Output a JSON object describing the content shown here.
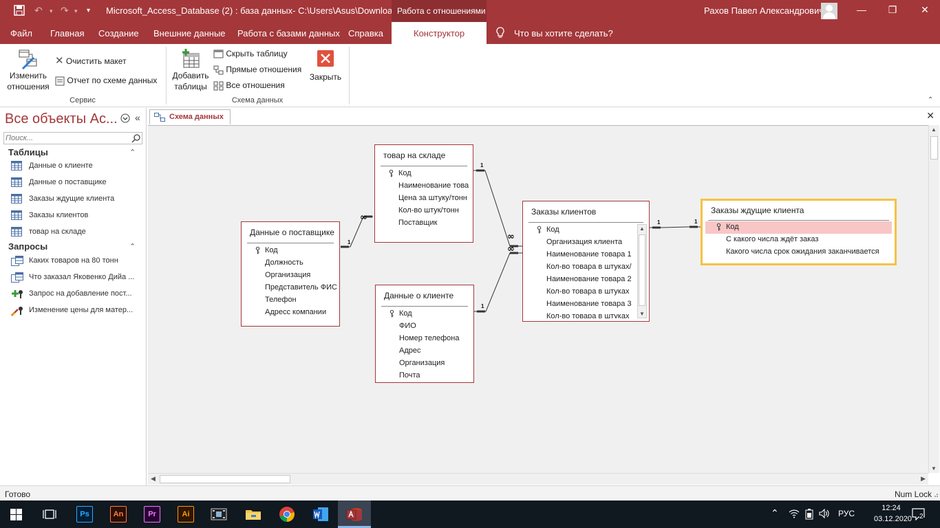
{
  "titlebar": {
    "title": "Microsoft_Access_Database (2) : база данных- C:\\Users\\Asus\\Downloads\\...",
    "context_tab": "Работа с отношениями",
    "user": "Рахов Павел Александрович"
  },
  "tabs": {
    "file": "Файл",
    "home": "Главная",
    "create": "Создание",
    "external": "Внешние данные",
    "database_tools": "Работа с базами данных",
    "help": "Справка",
    "designer": "Конструктор",
    "tell_me": "Что вы хотите сделать?"
  },
  "ribbon": {
    "edit_relationships": [
      "Изменить",
      "отношения"
    ],
    "clear_layout": "Очистить макет",
    "relationship_report": "Отчет по схеме данных",
    "group_tools": "Сервис",
    "add_tables": [
      "Добавить",
      "таблицы"
    ],
    "hide_table": "Скрыть таблицу",
    "direct_relationships": "Прямые отношения",
    "all_relationships": "Все отношения",
    "close": "Закрыть",
    "group_relationships": "Схема данных"
  },
  "nav": {
    "title": "Все объекты Ac...",
    "search_placeholder": "Поиск...",
    "tables_header": "Таблицы",
    "tables": [
      "Данные о клиенте",
      "Данные о поставщике",
      "Заказы ждущие клиента",
      "Заказы клиентов",
      "товар на складе"
    ],
    "queries_header": "Запросы",
    "queries": [
      "Каких товаров на 80 тонн",
      "Что заказал Яковенко Дийа ...",
      "Запрос на добавление пост...",
      "Изменение цены для матер..."
    ]
  },
  "document": {
    "tab_label": "Схема данных"
  },
  "diagram": {
    "tables": [
      {
        "name": "товар на складе",
        "fields": [
          "Код",
          "Наименование това",
          "Цена за штуку/тонн",
          "Кол-во штук/тонн",
          "Поставщик"
        ]
      },
      {
        "name": "Данные о поставщике",
        "fields": [
          "Код",
          "Должность",
          "Организация",
          "Представитель ФИС",
          "Телефон",
          "Адресс компании"
        ]
      },
      {
        "name": "Данные о клиенте",
        "fields": [
          "Код",
          "ФИО",
          "Номер телефона",
          "Адрес",
          "Организация",
          "Почта"
        ]
      },
      {
        "name": "Заказы клиентов",
        "fields": [
          "Код",
          "Организация клиента",
          "Наименование товара 1",
          "Кол-во товара в штуках/",
          "Наименование товара 2",
          "Кол-во товара в штуках",
          "Наименование товара 3",
          "Кол-во товара в штуках"
        ]
      },
      {
        "name": "Заказы ждущие клиента",
        "fields": [
          "Код",
          "С какого числа ждёт заказ",
          "Какого числа срок ожидания заканчивается"
        ]
      }
    ],
    "one": "1",
    "many": "∞"
  },
  "status": {
    "left": "Готово",
    "right": "Num Lock"
  },
  "taskbar": {
    "lang": "РУС",
    "time": "12:24",
    "date": "03.12.2020",
    "notifications": "2",
    "apps": [
      "Ps",
      "An",
      "Pr",
      "Ai"
    ]
  },
  "colors": {
    "accent": "#a4373a",
    "selected_border": "#f5c242",
    "selected_field": "#f9c6c6"
  }
}
